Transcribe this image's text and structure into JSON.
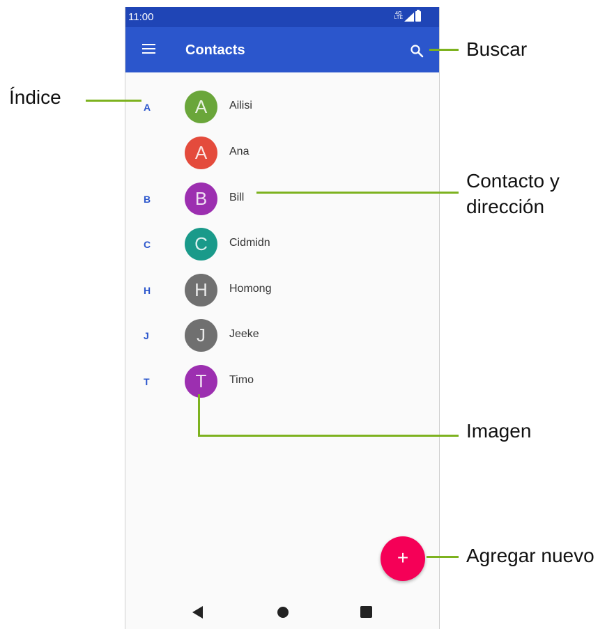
{
  "status_bar": {
    "time": "11:00",
    "network": "4G LTE"
  },
  "app_bar": {
    "title": "Contacts"
  },
  "contacts": [
    {
      "index": "A",
      "initial": "A",
      "name": "Ailisi",
      "avatar_color": "#6aa63a"
    },
    {
      "index": "",
      "initial": "A",
      "name": "Ana",
      "avatar_color": "#e44b3c"
    },
    {
      "index": "B",
      "initial": "B",
      "name": "Bill",
      "avatar_color": "#9c2fb0"
    },
    {
      "index": "C",
      "initial": "C",
      "name": "Cidmidn",
      "avatar_color": "#1a9a8a"
    },
    {
      "index": "H",
      "initial": "H",
      "name": "Homong",
      "avatar_color": "#707070"
    },
    {
      "index": "J",
      "initial": "J",
      "name": "Jeeke",
      "avatar_color": "#707070"
    },
    {
      "index": "T",
      "initial": "T",
      "name": "Timo",
      "avatar_color": "#9c2fb0"
    }
  ],
  "fab": {
    "label": "+",
    "color": "#f50057"
  },
  "callouts": {
    "search": "Buscar",
    "index": "Índice",
    "contact_line1": "Contacto y",
    "contact_line2": "dirección",
    "image": "Imagen",
    "add_new": "Agregar nuevo"
  },
  "colors": {
    "accent": "#2b56cc",
    "callout_line": "#7db21f"
  },
  "icons": [
    "menu-icon",
    "search-icon",
    "back-icon",
    "home-icon",
    "recent-apps-icon",
    "signal-icon",
    "battery-icon"
  ]
}
